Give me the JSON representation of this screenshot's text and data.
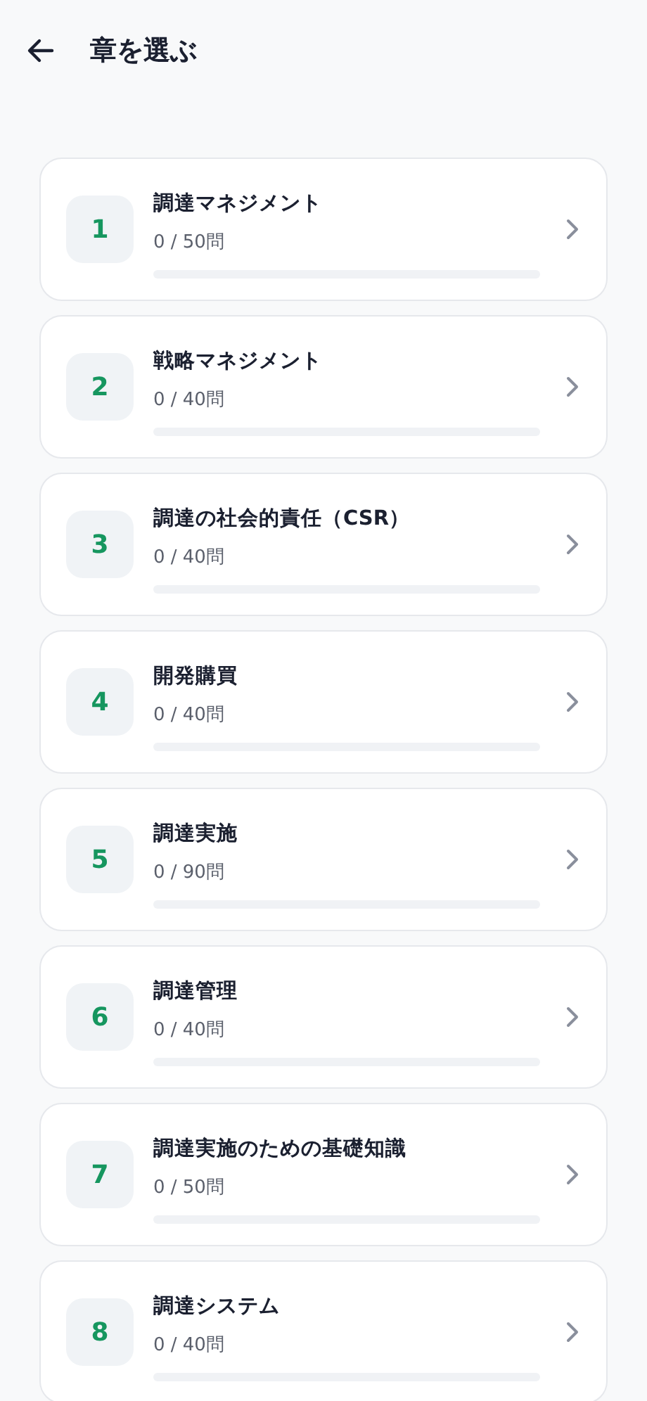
{
  "header": {
    "title": "章を選ぶ"
  },
  "chapters": [
    {
      "number": "1",
      "title": "調達マネジメント",
      "progress": "0 / 50問",
      "level": 0
    },
    {
      "number": "2",
      "title": "戦略マネジメント",
      "progress": "0 / 40問",
      "level": 0
    },
    {
      "number": "3",
      "title": "調達の社会的責任（CSR）",
      "progress": "0 / 40問",
      "level": 0
    },
    {
      "number": "4",
      "title": "開発購買",
      "progress": "0 / 40問",
      "level": 0
    },
    {
      "number": "5",
      "title": "調達実施",
      "progress": "0 / 90問",
      "level": 0
    },
    {
      "number": "6",
      "title": "調達管理",
      "progress": "0 / 40問",
      "level": 0
    },
    {
      "number": "7",
      "title": "調達実施のための基礎知識",
      "progress": "0 / 50問",
      "level": 0
    },
    {
      "number": "8",
      "title": "調達システム",
      "progress": "0 / 40問",
      "level": 0
    }
  ]
}
